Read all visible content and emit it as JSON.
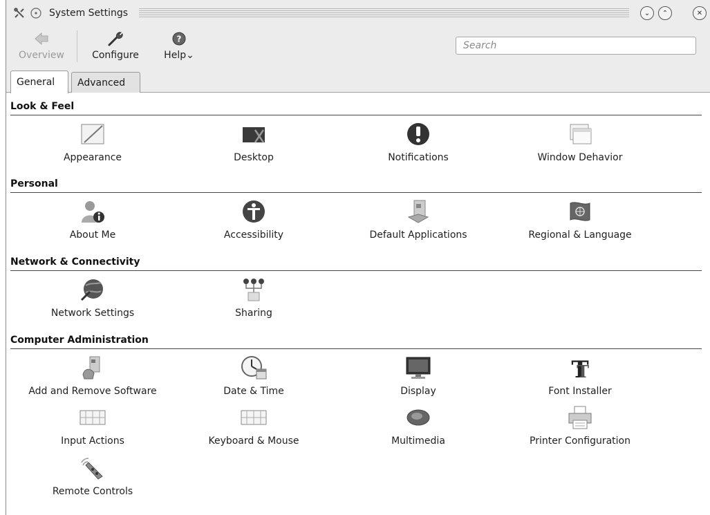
{
  "window": {
    "title": "System Settings",
    "title_icon": "tools-icon",
    "pin_icon": "pin-icon",
    "minimize_glyph": "⌄",
    "maximize_glyph": "⌃",
    "close_glyph": "✕"
  },
  "toolbar": {
    "overview_label": "Overview",
    "configure_label": "Configure",
    "help_label": "Help⌄",
    "search_placeholder": "Search",
    "search_value": ""
  },
  "tabs": [
    {
      "label": "General",
      "selected": true
    },
    {
      "label": "Advanced",
      "selected": false
    }
  ],
  "sections": [
    {
      "title": "Look & Feel",
      "items": [
        {
          "label": "Appearance",
          "icon": "appearance-icon"
        },
        {
          "label": "Desktop",
          "icon": "desktop-icon"
        },
        {
          "label": "Notifications",
          "icon": "notifications-icon"
        },
        {
          "label": "Window Dehavior",
          "icon": "window-behavior-icon"
        }
      ]
    },
    {
      "title": "Personal",
      "items": [
        {
          "label": "About Me",
          "icon": "about-me-icon"
        },
        {
          "label": "Accessibility",
          "icon": "accessibility-icon"
        },
        {
          "label": "Default Applications",
          "icon": "default-applications-icon"
        },
        {
          "label": "Regional & Language",
          "icon": "regional-language-icon"
        }
      ]
    },
    {
      "title": "Network & Connectivity",
      "items": [
        {
          "label": "Network Settings",
          "icon": "network-settings-icon"
        },
        {
          "label": "Sharing",
          "icon": "sharing-icon"
        }
      ]
    },
    {
      "title": "Computer Administration",
      "items": [
        {
          "label": "Add and Remove Software",
          "icon": "add-remove-software-icon"
        },
        {
          "label": "Date & Time",
          "icon": "date-time-icon"
        },
        {
          "label": "Display",
          "icon": "display-icon"
        },
        {
          "label": "Font Installer",
          "icon": "font-installer-icon"
        },
        {
          "label": "Input Actions",
          "icon": "input-actions-icon"
        },
        {
          "label": "Keyboard & Mouse",
          "icon": "keyboard-mouse-icon"
        },
        {
          "label": "Multimedia",
          "icon": "multimedia-icon"
        },
        {
          "label": "Printer Configuration",
          "icon": "printer-configuration-icon"
        },
        {
          "label": "Remote Controls",
          "icon": "remote-controls-icon"
        }
      ]
    }
  ]
}
